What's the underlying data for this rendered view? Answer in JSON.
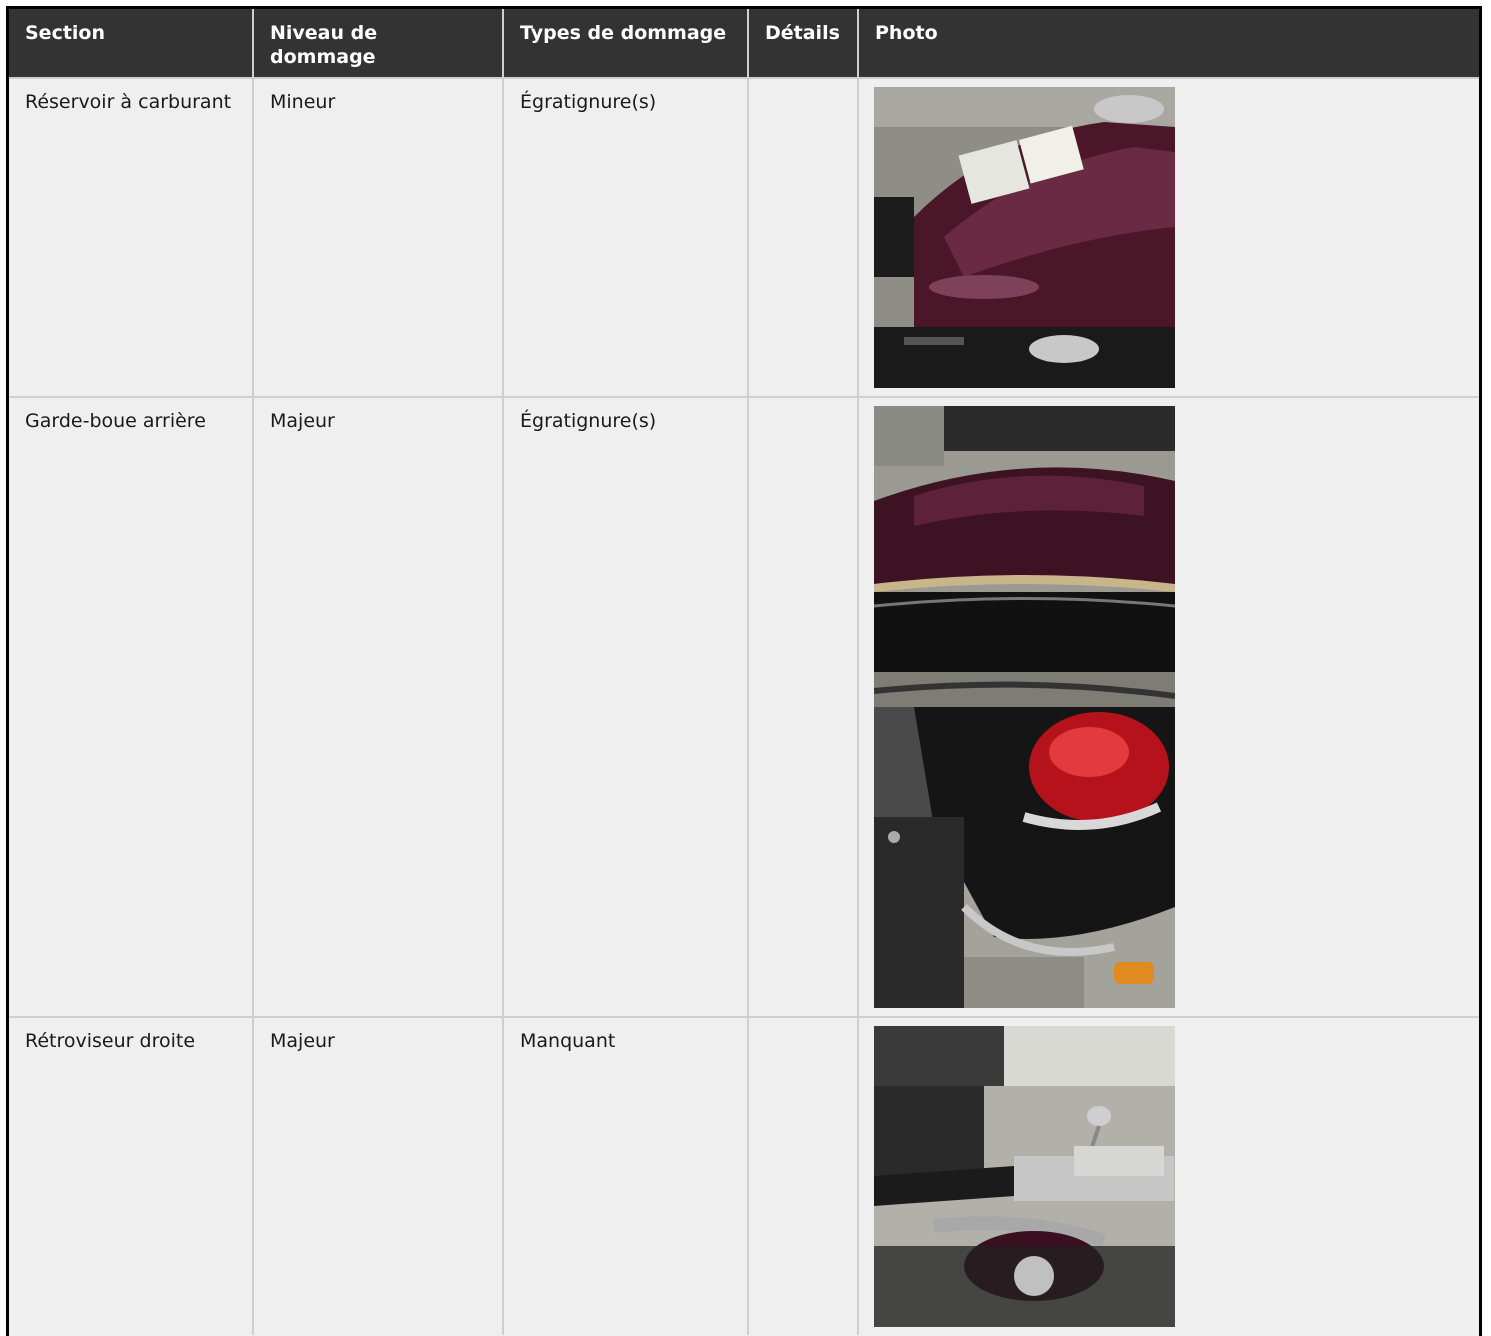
{
  "headers": {
    "section": "Section",
    "level": "Niveau de dommage",
    "types": "Types de dommage",
    "details": "Détails",
    "photo": "Photo"
  },
  "rows": [
    {
      "section": "Réservoir à carburant",
      "level": "Mineur",
      "types": "Égratignure(s)",
      "details": "",
      "photos": [
        "fuel-tank-photo"
      ]
    },
    {
      "section": "Garde-boue arrière",
      "level": "Majeur",
      "types": "Égratignure(s)",
      "details": "",
      "photos": [
        "rear-fender-photo",
        "rear-fender-light-photo"
      ]
    },
    {
      "section": "Rétroviseur droite",
      "level": "Majeur",
      "types": "Manquant",
      "details": "",
      "photos": [
        "right-mirror-photo"
      ]
    }
  ]
}
